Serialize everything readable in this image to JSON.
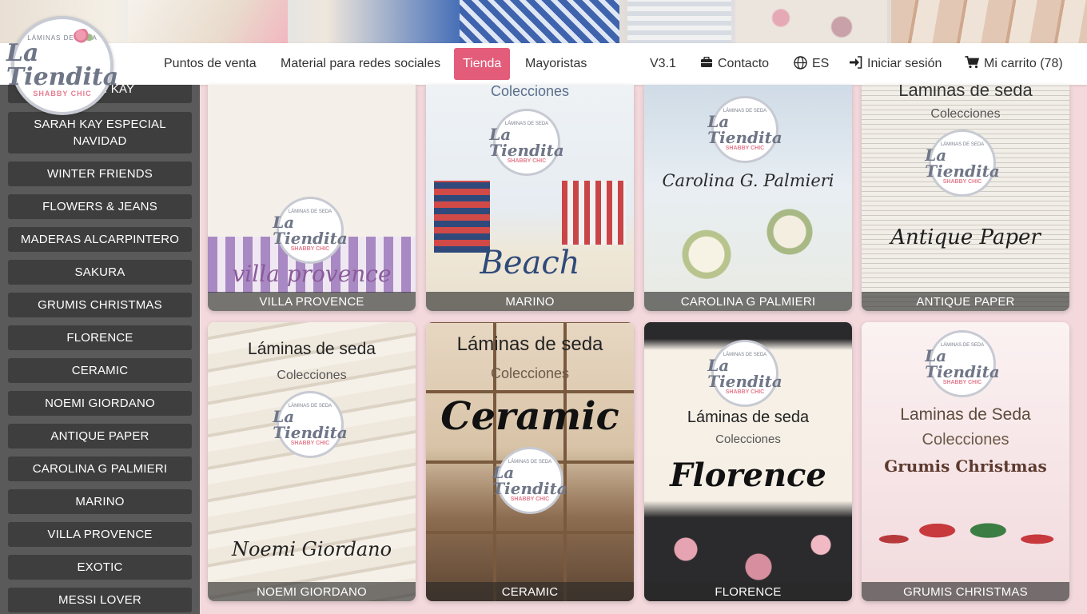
{
  "logo": {
    "top": "LÁMINAS DE SEDA",
    "main": "La Tiendita",
    "bottom": "SHABBY CHIC"
  },
  "nav": {
    "puntos": "Puntos de venta",
    "material": "Material para redes sociales",
    "tienda": "Tienda",
    "mayoristas": "Mayoristas",
    "version": "V3.1",
    "contacto": "Contacto",
    "lang": "ES",
    "login": "Iniciar sesión",
    "cart": "Mi carrito (78)"
  },
  "sidebar": {
    "items": [
      {
        "label": "SARAH KAY"
      },
      {
        "label": "SARAH KAY ESPECIAL NAVIDAD"
      },
      {
        "label": "WINTER FRIENDS"
      },
      {
        "label": "FLOWERS & JEANS"
      },
      {
        "label": "MADERAS ALCARPINTERO"
      },
      {
        "label": "SAKURA"
      },
      {
        "label": "GRUMIS CHRISTMAS"
      },
      {
        "label": "FLORENCE"
      },
      {
        "label": "CERAMIC"
      },
      {
        "label": "NOEMI GIORDANO"
      },
      {
        "label": "ANTIQUE PAPER"
      },
      {
        "label": "CAROLINA G PALMIERI"
      },
      {
        "label": "MARINO"
      },
      {
        "label": "VILLA PROVENCE"
      },
      {
        "label": "EXOTIC"
      },
      {
        "label": "MESSI LOVER"
      }
    ]
  },
  "grid": {
    "cards": [
      {
        "caption": "VILLA PROVENCE",
        "overlay": "villa provence"
      },
      {
        "caption": "MARINO",
        "overlay": "Beach",
        "top": "Colecciones"
      },
      {
        "caption": "CAROLINA G PALMIERI",
        "overlay": "Carolina G. Palmieri"
      },
      {
        "caption": "ANTIQUE PAPER",
        "overlay": "Antique Paper",
        "top": "Laminas de seda",
        "sub": "Colecciones"
      },
      {
        "caption": "NOEMI GIORDANO",
        "overlay": "Noemi Giordano",
        "top": "Láminas de seda",
        "sub": "Colecciones"
      },
      {
        "caption": "CERAMIC",
        "overlay": "Ceramic",
        "top": "Láminas de seda",
        "sub": "Colecciones"
      },
      {
        "caption": "FLORENCE",
        "overlay": "Florence",
        "top": "Láminas de seda",
        "sub": "Colecciones"
      },
      {
        "caption": "GRUMIS CHRISTMAS",
        "overlay": "Grumis Christmas",
        "top": "Laminas de Seda",
        "sub": "Colecciones"
      }
    ]
  },
  "colors": {
    "accent": "#e35d7a",
    "sidebar_bg": "#5a5a5a",
    "sidebar_item": "#3e3e3e"
  }
}
